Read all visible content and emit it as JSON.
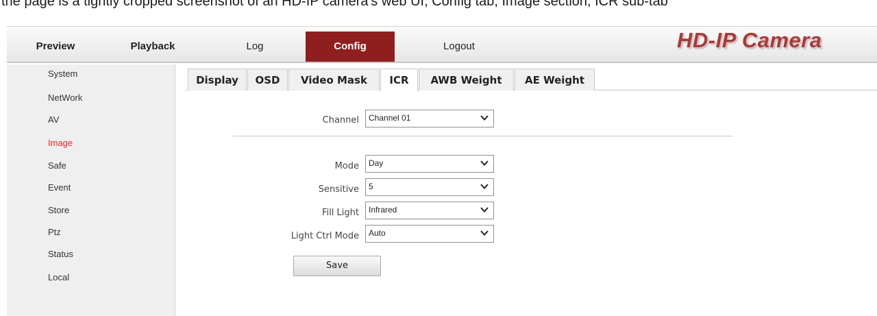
{
  "caption": {
    "text": "the page is a tightly cropped screenshot of an HD-IP camera's web UI, Config tab, Image section, ICR sub-tab"
  },
  "nav": {
    "items": [
      {
        "label": "Preview"
      },
      {
        "label": "Playback"
      },
      {
        "label": "Log"
      },
      {
        "label": "Config"
      },
      {
        "label": "Logout"
      }
    ],
    "active": "Config",
    "brand": "HD-IP Camera",
    "active_color": "#8f1f1f"
  },
  "sidebar": {
    "items": [
      {
        "label": "System"
      },
      {
        "label": "NetWork"
      },
      {
        "label": "AV"
      },
      {
        "label": "Image"
      },
      {
        "label": "Safe"
      },
      {
        "label": "Event"
      },
      {
        "label": "Store"
      },
      {
        "label": "Ptz"
      },
      {
        "label": "Status"
      },
      {
        "label": "Local"
      }
    ],
    "active": "Image",
    "active_color": "#e82525"
  },
  "tabs": {
    "items": [
      {
        "label": "Display"
      },
      {
        "label": "OSD"
      },
      {
        "label": "Video Mask"
      },
      {
        "label": "ICR"
      },
      {
        "label": "AWB Weight"
      },
      {
        "label": "AE Weight"
      }
    ],
    "active": "ICR"
  },
  "form": {
    "channel": {
      "label": "Channel",
      "value": "Channel 01"
    },
    "mode": {
      "label": "Mode",
      "value": "Day"
    },
    "sensitive": {
      "label": "Sensitive",
      "value": "5"
    },
    "fill_light": {
      "label": "Fill Light",
      "value": "Infrared"
    },
    "light_ctrl_mode": {
      "label": "Light Ctrl Mode",
      "value": "Auto"
    },
    "save_label": "Save"
  }
}
